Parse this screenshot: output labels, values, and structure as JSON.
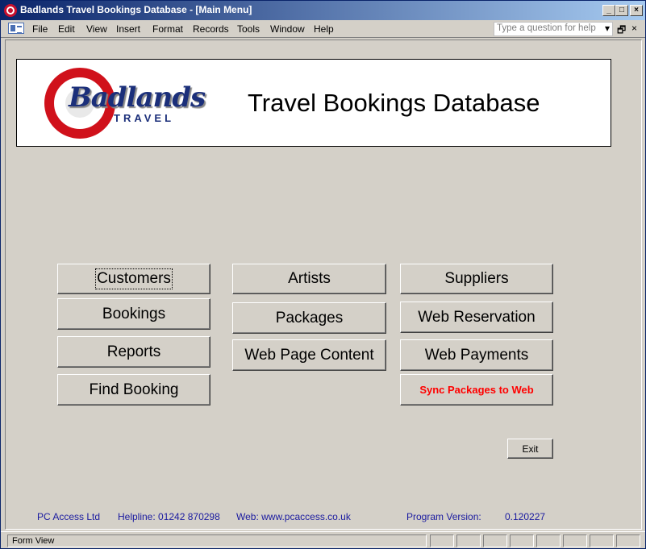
{
  "window": {
    "title": "Badlands Travel Bookings Database - [Main Menu]",
    "controls": {
      "minimize": "_",
      "maximize": "□",
      "close": "×"
    }
  },
  "menubar": {
    "items": [
      "File",
      "Edit",
      "View",
      "Insert",
      "Format",
      "Records",
      "Tools",
      "Window",
      "Help"
    ],
    "help_placeholder": "Type a question for help",
    "doc_controls": {
      "dropdown": "▾",
      "restore": "🗗",
      "close": "×"
    }
  },
  "header": {
    "logo_word": "Badlands",
    "logo_sub": "TRAVEL",
    "title": "Travel Bookings Database",
    "logo_colors": {
      "ring": "#d0111b",
      "text": "#1b2f7a"
    }
  },
  "buttons": {
    "customers": "Customers",
    "bookings": "Bookings",
    "reports": "Reports",
    "find_booking": "Find Booking",
    "artists": "Artists",
    "packages": "Packages",
    "web_page_content": "Web Page Content",
    "suppliers": "Suppliers",
    "web_reservation": "Web Reservation",
    "web_payments": "Web Payments",
    "sync_packages": "Sync Packages to Web",
    "exit": "Exit"
  },
  "footer": {
    "company": "PC Access Ltd",
    "helpline": "Helpline: 01242 870298",
    "web": "Web: www.pcaccess.co.uk",
    "version_label": "Program Version:",
    "version_value": "0.120227"
  },
  "statusbar": {
    "text": "Form View"
  }
}
